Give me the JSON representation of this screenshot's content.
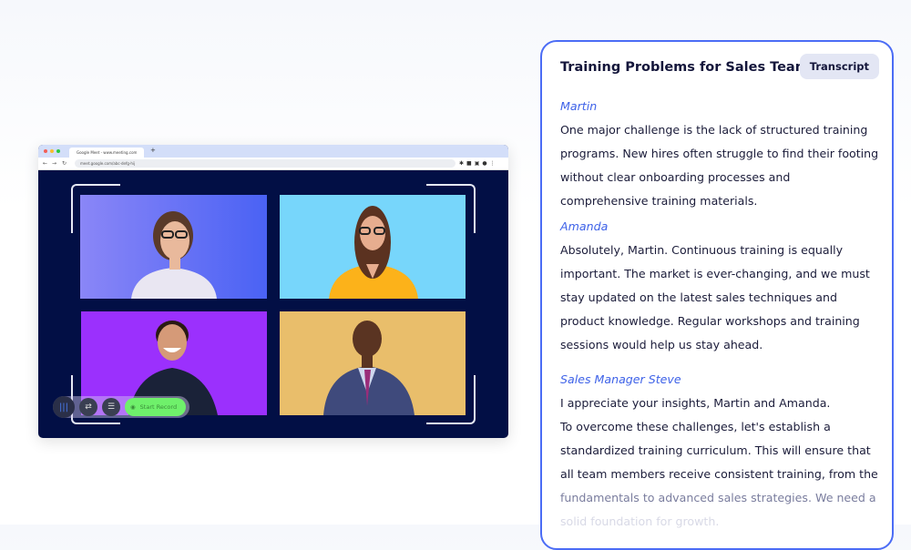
{
  "browser": {
    "tab_title": "Google Meet - www.meeting.com",
    "url": "meet.google.com/abc-defg-hij"
  },
  "controls": {
    "record_label": "Start Record"
  },
  "transcript": {
    "title": "Training Problems for Sales Team",
    "badge": "Transcript",
    "entries": [
      {
        "speaker": "Martin",
        "text": "One major challenge is the lack of structured training programs. New hires often struggle to find their footing without clear onboarding processes and comprehensive training materials."
      },
      {
        "speaker": "Amanda",
        "text": "Absolutely, Martin. Continuous training is equally important.  The market is ever-changing, and we must stay updated on the latest sales techniques and product knowledge. Regular workshops and training sessions would help us stay ahead."
      },
      {
        "speaker": "Sales Manager Steve",
        "text": "I appreciate your insights, Martin and Amanda.",
        "text2": "To overcome these challenges, let's establish a standardized training curriculum. This will ensure that all team members receive consistent training, from the",
        "text3": "fundamentals to advanced sales strategies. We need a",
        "text4": "solid foundation for growth."
      }
    ]
  },
  "colors": {
    "accent": "#4b6cf5",
    "speaker": "#3e62e8",
    "record": "#6ff06b",
    "stage": "#020f45"
  }
}
